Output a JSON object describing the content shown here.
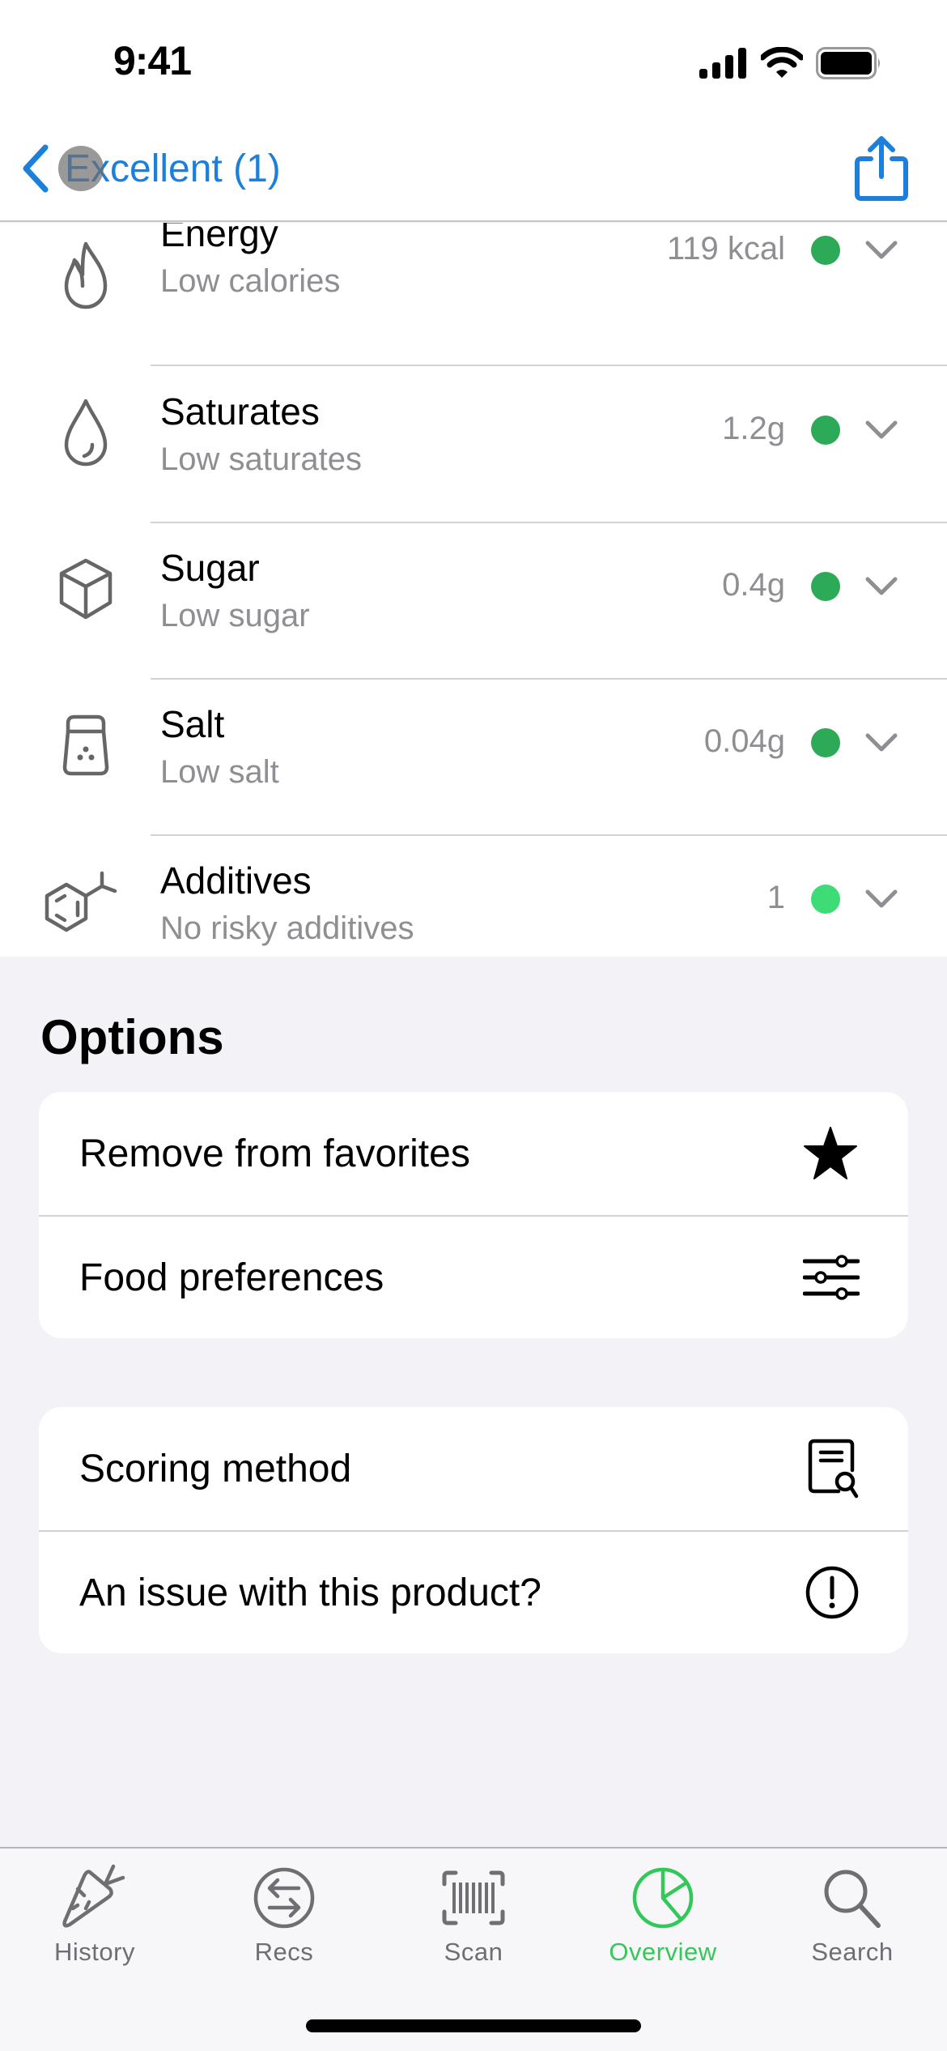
{
  "status_bar": {
    "time": "9:41",
    "icons": [
      "cellular-signal-icon",
      "wifi-icon",
      "battery-icon"
    ]
  },
  "nav": {
    "back_label": "Excellent (1)",
    "back_icon": "chevron-left-icon",
    "share_icon": "share-icon",
    "accent_color": "#1C7FD9"
  },
  "nutrients": [
    {
      "name": "Energy",
      "subtitle": "Low calories",
      "value": "119 kcal",
      "icon": "flame-icon",
      "status_color": "#2DAA57"
    },
    {
      "name": "Saturates",
      "subtitle": "Low saturates",
      "value": "1.2g",
      "icon": "drop-icon",
      "status_color": "#2DAA57"
    },
    {
      "name": "Sugar",
      "subtitle": "Low sugar",
      "value": "0.4g",
      "icon": "sugar-cube-icon",
      "status_color": "#2DAA57"
    },
    {
      "name": "Salt",
      "subtitle": "Low salt",
      "value": "0.04g",
      "icon": "salt-shaker-icon",
      "status_color": "#2DAA57"
    },
    {
      "name": "Additives",
      "subtitle": "No risky additives",
      "value": "1",
      "icon": "molecule-icon",
      "status_color": "#3DDC77"
    }
  ],
  "options": {
    "title": "Options",
    "group1": [
      {
        "label": "Remove from favorites",
        "icon": "star-icon"
      },
      {
        "label": "Food preferences",
        "icon": "sliders-icon"
      }
    ],
    "group2": [
      {
        "label": "Scoring method",
        "icon": "document-search-icon"
      },
      {
        "label": "An issue with this product?",
        "icon": "exclamation-circle-icon"
      }
    ]
  },
  "tab_bar": {
    "active": "Overview",
    "active_color": "#34C759",
    "items": [
      {
        "label": "History",
        "icon": "carrot-icon"
      },
      {
        "label": "Recs",
        "icon": "swap-arrows-icon"
      },
      {
        "label": "Scan",
        "icon": "barcode-scan-icon"
      },
      {
        "label": "Overview",
        "icon": "pie-chart-icon"
      },
      {
        "label": "Search",
        "icon": "magnifier-icon"
      }
    ]
  }
}
